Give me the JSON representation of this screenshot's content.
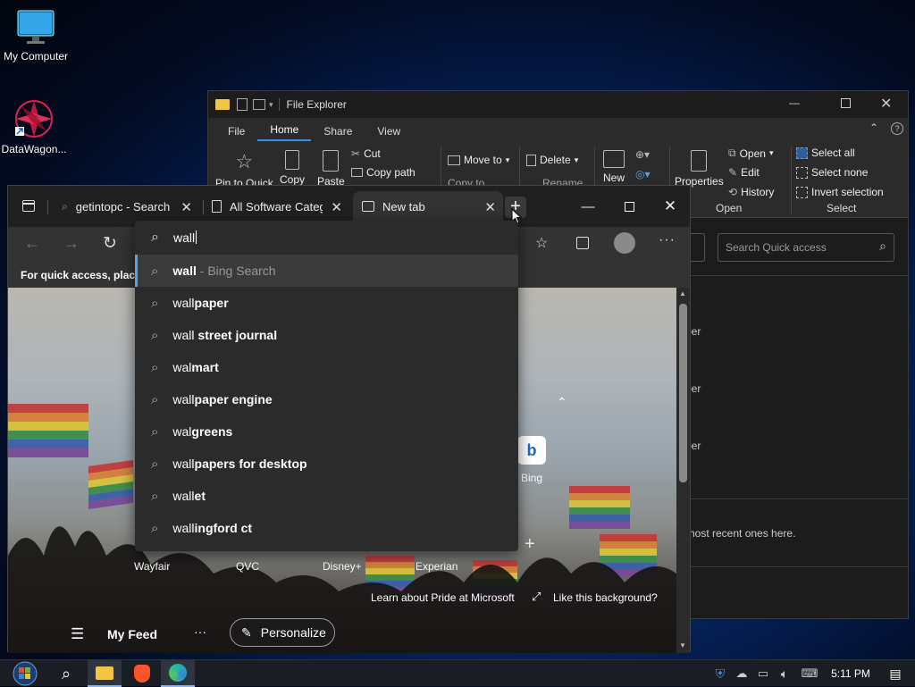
{
  "desktop": {
    "icons": [
      {
        "label": "My Computer",
        "icon": "monitor-icon"
      },
      {
        "label": "DataWagon...",
        "icon": "datawagon-app-icon"
      }
    ]
  },
  "explorer": {
    "title": "File Explorer",
    "tabs": [
      "File",
      "Home",
      "Share",
      "View"
    ],
    "active_tab": "Home",
    "clipboard": {
      "pin": "Pin to Quick",
      "copy": "Copy",
      "paste": "Paste",
      "cut": "Cut",
      "copy_path": "Copy path"
    },
    "organize": {
      "move_to": "Move to",
      "copy_to": "Copy to",
      "delete": "Delete",
      "rename": "Rename"
    },
    "new": {
      "new": "New"
    },
    "open_group": {
      "properties": "Properties",
      "open": "Open",
      "edit": "Edit",
      "history": "History",
      "group_label": "Open"
    },
    "select_group": {
      "select_all": "Select all",
      "select_none": "Select none",
      "invert": "Invert selection",
      "group_label": "Select"
    },
    "search_placeholder": "Search Quick access",
    "list_fragments": [
      "per",
      "per",
      "per"
    ],
    "recent_text": "nost recent ones here."
  },
  "edge": {
    "tabs": [
      {
        "label": "getintopc - Search",
        "icon": "search-icon"
      },
      {
        "label": "All Software Categ",
        "icon": "page-icon"
      },
      {
        "label": "New tab",
        "icon": "newtab-icon"
      }
    ],
    "address_value": "wall",
    "favorites_hint": "For quick access, place y",
    "tiles": [
      "Wayfair",
      "QVC",
      "Disney+",
      "Experian",
      "Bing"
    ],
    "pride_link": "Learn about Pride at Microsoft",
    "background_link": "Like this background?",
    "feed_label": "My Feed",
    "personalize": "Personalize"
  },
  "suggestions": [
    {
      "typed": "wall",
      "rest": "",
      "suffix": " - Bing Search"
    },
    {
      "typed": "wall",
      "rest": "paper",
      "suffix": ""
    },
    {
      "typed": "wall",
      "rest": " street journal",
      "suffix": ""
    },
    {
      "typed": "wal",
      "rest": "mart",
      "suffix": ""
    },
    {
      "typed": "wall",
      "rest": "paper engine",
      "suffix": ""
    },
    {
      "typed": "wal",
      "rest": "greens",
      "suffix": ""
    },
    {
      "typed": "wall",
      "rest": "papers for desktop",
      "suffix": ""
    },
    {
      "typed": "wall",
      "rest": "et",
      "suffix": ""
    },
    {
      "typed": "wall",
      "rest": "ingford ct",
      "suffix": ""
    }
  ],
  "taskbar": {
    "clock": "5:11 PM",
    "apps": [
      "start-orb-icon",
      "search-icon",
      "file-explorer-icon",
      "brave-icon",
      "edge-icon"
    ]
  },
  "colors": {
    "accent": "#3b8eea",
    "edge_bg": "#333333",
    "taskbar": "#1a1e24"
  }
}
